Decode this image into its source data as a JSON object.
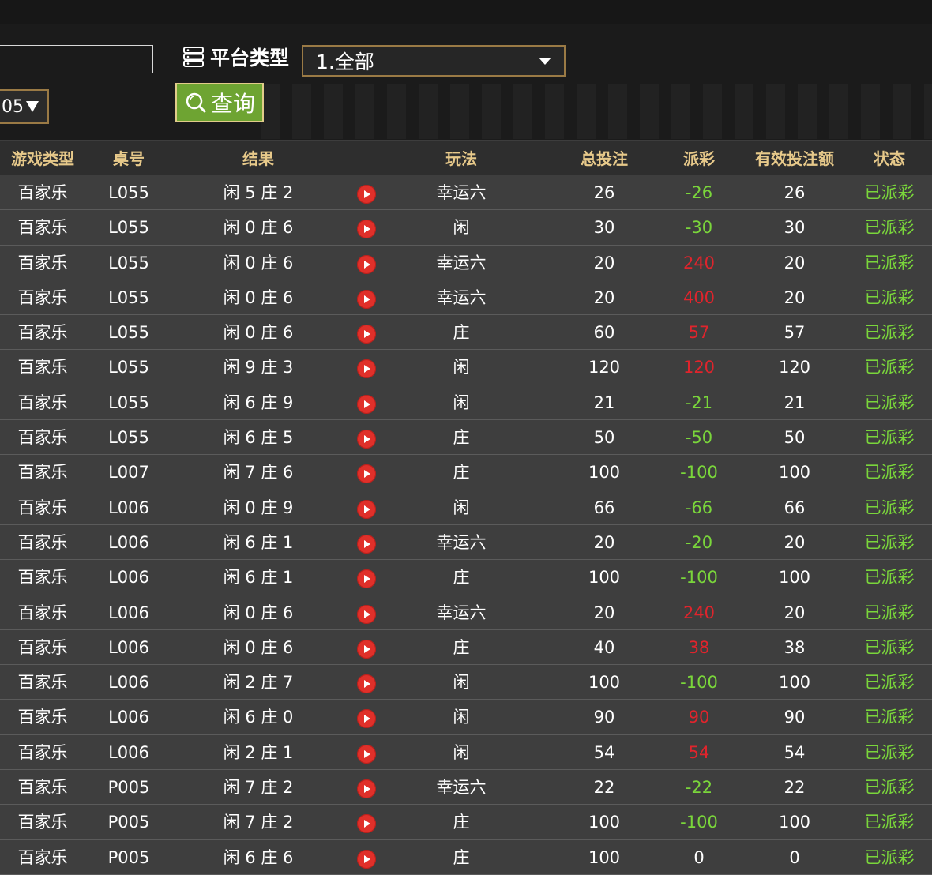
{
  "filters": {
    "platform_label": "平台类型",
    "platform_selected": "1.全部",
    "table_select_value": "05",
    "query_label": "查询"
  },
  "table": {
    "headers": [
      "游戏类型",
      "桌号",
      "结果",
      "玩法",
      "总投注",
      "派彩",
      "有效投注额",
      "状态"
    ],
    "rows": [
      {
        "game": "百家乐",
        "table": "L055",
        "result": "闲 5 庄 2",
        "bet": "幸运六",
        "total": "26",
        "payout": "-26",
        "valid": "26",
        "status": "已派彩"
      },
      {
        "game": "百家乐",
        "table": "L055",
        "result": "闲 0 庄 6",
        "bet": "闲",
        "total": "30",
        "payout": "-30",
        "valid": "30",
        "status": "已派彩"
      },
      {
        "game": "百家乐",
        "table": "L055",
        "result": "闲 0 庄 6",
        "bet": "幸运六",
        "total": "20",
        "payout": "240",
        "valid": "20",
        "status": "已派彩"
      },
      {
        "game": "百家乐",
        "table": "L055",
        "result": "闲 0 庄 6",
        "bet": "幸运六",
        "total": "20",
        "payout": "400",
        "valid": "20",
        "status": "已派彩"
      },
      {
        "game": "百家乐",
        "table": "L055",
        "result": "闲 0 庄 6",
        "bet": "庄",
        "total": "60",
        "payout": "57",
        "valid": "57",
        "status": "已派彩"
      },
      {
        "game": "百家乐",
        "table": "L055",
        "result": "闲 9 庄 3",
        "bet": "闲",
        "total": "120",
        "payout": "120",
        "valid": "120",
        "status": "已派彩"
      },
      {
        "game": "百家乐",
        "table": "L055",
        "result": "闲 6 庄 9",
        "bet": "闲",
        "total": "21",
        "payout": "-21",
        "valid": "21",
        "status": "已派彩"
      },
      {
        "game": "百家乐",
        "table": "L055",
        "result": "闲 6 庄 5",
        "bet": "庄",
        "total": "50",
        "payout": "-50",
        "valid": "50",
        "status": "已派彩"
      },
      {
        "game": "百家乐",
        "table": "L007",
        "result": "闲 7 庄 6",
        "bet": "庄",
        "total": "100",
        "payout": "-100",
        "valid": "100",
        "status": "已派彩"
      },
      {
        "game": "百家乐",
        "table": "L006",
        "result": "闲 0 庄 9",
        "bet": "闲",
        "total": "66",
        "payout": "-66",
        "valid": "66",
        "status": "已派彩"
      },
      {
        "game": "百家乐",
        "table": "L006",
        "result": "闲 6 庄 1",
        "bet": "幸运六",
        "total": "20",
        "payout": "-20",
        "valid": "20",
        "status": "已派彩"
      },
      {
        "game": "百家乐",
        "table": "L006",
        "result": "闲 6 庄 1",
        "bet": "庄",
        "total": "100",
        "payout": "-100",
        "valid": "100",
        "status": "已派彩"
      },
      {
        "game": "百家乐",
        "table": "L006",
        "result": "闲 0 庄 6",
        "bet": "幸运六",
        "total": "20",
        "payout": "240",
        "valid": "20",
        "status": "已派彩"
      },
      {
        "game": "百家乐",
        "table": "L006",
        "result": "闲 0 庄 6",
        "bet": "庄",
        "total": "40",
        "payout": "38",
        "valid": "38",
        "status": "已派彩"
      },
      {
        "game": "百家乐",
        "table": "L006",
        "result": "闲 2 庄 7",
        "bet": "闲",
        "total": "100",
        "payout": "-100",
        "valid": "100",
        "status": "已派彩"
      },
      {
        "game": "百家乐",
        "table": "L006",
        "result": "闲 6 庄 0",
        "bet": "闲",
        "total": "90",
        "payout": "90",
        "valid": "90",
        "status": "已派彩"
      },
      {
        "game": "百家乐",
        "table": "L006",
        "result": "闲 2 庄 1",
        "bet": "闲",
        "total": "54",
        "payout": "54",
        "valid": "54",
        "status": "已派彩"
      },
      {
        "game": "百家乐",
        "table": "P005",
        "result": "闲 7 庄 2",
        "bet": "幸运六",
        "total": "22",
        "payout": "-22",
        "valid": "22",
        "status": "已派彩"
      },
      {
        "game": "百家乐",
        "table": "P005",
        "result": "闲 7 庄 2",
        "bet": "庄",
        "total": "100",
        "payout": "-100",
        "valid": "100",
        "status": "已派彩"
      },
      {
        "game": "百家乐",
        "table": "P005",
        "result": "闲 6 庄 6",
        "bet": "庄",
        "total": "100",
        "payout": "0",
        "valid": "0",
        "status": "已派彩"
      }
    ]
  },
  "colors": {
    "header_text": "#e7c98a",
    "payout_negative": "#7ad63b",
    "payout_positive": "#e0242c",
    "status_text": "#7ad63b",
    "query_button": "#6ea432"
  }
}
